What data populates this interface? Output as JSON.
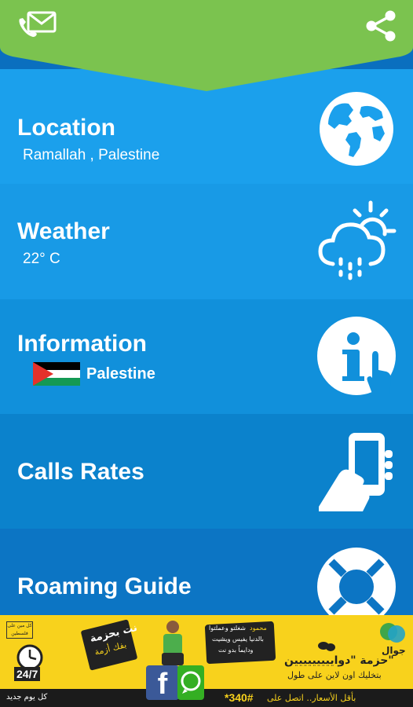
{
  "header": {
    "left_icon": "message-envelope-icon",
    "right_icon": "share-icon",
    "accent": "#7bc34f"
  },
  "menu": {
    "location": {
      "title": "Location",
      "value": "Ramallah , Palestine",
      "icon": "globe-icon"
    },
    "weather": {
      "title": "Weather",
      "value": "22° C",
      "icon": "weather-cloud-sun-rain-icon"
    },
    "information": {
      "title": "Information",
      "country": "Palestine",
      "icon": "info-touch-icon"
    },
    "calls": {
      "title": "Calls Rates",
      "icon": "phone-in-hand-icon"
    },
    "roaming": {
      "title": "Roaming Guide",
      "icon": "lifebuoy-icon"
    }
  },
  "ad": {
    "brand": "جوال",
    "tag_small": "كل يوم جديد",
    "hours": "24/7",
    "box_top": "كل مين على فلسطين",
    "bubble_left_1": "نت بحزمة",
    "bubble_left_2": "بفك أزمة",
    "bubble_right_name": "محمود",
    "bubble_right_1": "شغلتو وعملتوا",
    "bubble_right_2": "بالدنيا يفيس ويشيت",
    "bubble_right_3": "ودايماً بدو نت",
    "headline": "حزمة \"دواييييييييين\"",
    "sub": "بتخليك اون لاين على طول",
    "bottom": "بأقل الأسعار.. اتصل على",
    "code": "*340#"
  }
}
